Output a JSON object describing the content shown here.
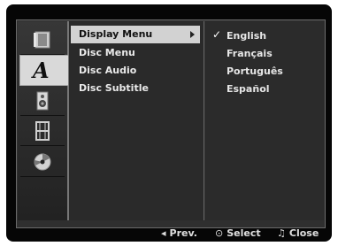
{
  "icons": [
    {
      "name": "disc-tray-icon"
    },
    {
      "name": "language-icon",
      "glyph": "A"
    },
    {
      "name": "speaker-icon"
    },
    {
      "name": "film-icon"
    },
    {
      "name": "disc-icon"
    }
  ],
  "menu": {
    "items": [
      {
        "label": "Display Menu"
      },
      {
        "label": "Disc Menu"
      },
      {
        "label": "Disc Audio"
      },
      {
        "label": "Disc Subtitle"
      }
    ]
  },
  "options": {
    "selected_mark": "✓",
    "items": [
      {
        "label": "English"
      },
      {
        "label": "Français"
      },
      {
        "label": "Português"
      },
      {
        "label": "Español"
      }
    ]
  },
  "footer": {
    "prev_symbol": "◂",
    "prev_label": "Prev.",
    "select_symbol": "⊙",
    "select_label": "Select",
    "close_symbol": "♫",
    "close_label": "Close"
  },
  "colors": {
    "background": "#2f2f2f",
    "highlight": "#d2d2d2",
    "text": "#eaeaea"
  }
}
